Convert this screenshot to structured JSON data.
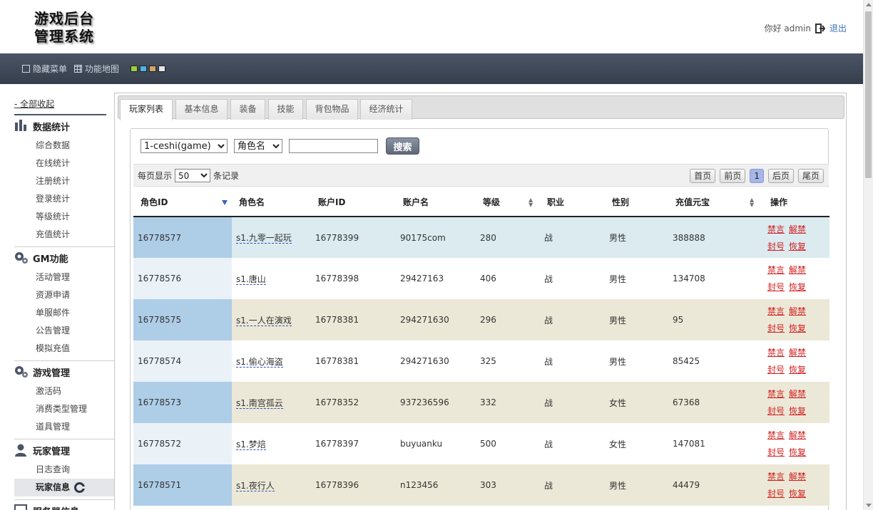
{
  "header": {
    "logo_line1": "游戏后台",
    "logo_line2": "管理系统",
    "greeting": "你好 admin",
    "logout": "退出"
  },
  "toolbar": {
    "hide_menu": "隐藏菜单",
    "function_map": "功能地图",
    "theme_colors": [
      "#9bd13a",
      "#4db4e6",
      "#c9a86b",
      "#e6e6e6"
    ]
  },
  "sidebar": {
    "collapse_all": "- 全部收起",
    "groups": [
      {
        "title": "数据统计",
        "icon": "bar-chart-icon",
        "items": [
          "综合数据",
          "在线统计",
          "注册统计",
          "登录统计",
          "等级统计",
          "充值统计"
        ]
      },
      {
        "title": "GM功能",
        "icon": "gears-icon",
        "items": [
          "活动管理",
          "资源申请",
          "单服邮件",
          "公告管理",
          "模拟充值"
        ]
      },
      {
        "title": "游戏管理",
        "icon": "gears-icon",
        "items": [
          "激活码",
          "消费类型管理",
          "道具管理"
        ]
      },
      {
        "title": "玩家管理",
        "icon": "user-icon",
        "items": [
          "日志查询",
          "玩家信息"
        ]
      },
      {
        "title": "服务器信息",
        "icon": "monitor-icon",
        "items": []
      }
    ],
    "active_item": "玩家信息"
  },
  "tabs": [
    "玩家列表",
    "基本信息",
    "装备",
    "技能",
    "背包物品",
    "经济统计"
  ],
  "filters": {
    "server_selected": "1-ceshi(game)",
    "field_selected": "角色名",
    "search_value": "",
    "search_button": "搜索"
  },
  "paging": {
    "prefix": "每页显示",
    "page_size": "50",
    "suffix": "条记录",
    "first": "首页",
    "prev": "前页",
    "current": "1",
    "next": "后页",
    "last": "尾页"
  },
  "table": {
    "columns": [
      "角色ID",
      "角色名",
      "账户ID",
      "账户名",
      "等级",
      "职业",
      "性别",
      "充值元宝",
      "操作"
    ],
    "op_labels": {
      "mute": "禁言",
      "unmute": "解禁",
      "ban": "封号",
      "restore": "恢复"
    },
    "rows": [
      {
        "role_id": "16778577",
        "role_name": "s1.九零一起玩",
        "account_id": "16778399",
        "account_name": "90175com",
        "level": "280",
        "job": "战",
        "gender": "男性",
        "gold": "388888"
      },
      {
        "role_id": "16778576",
        "role_name": "s1.唐山",
        "account_id": "16778398",
        "account_name": "29427163",
        "level": "406",
        "job": "战",
        "gender": "男性",
        "gold": "134708"
      },
      {
        "role_id": "16778575",
        "role_name": "s1.一人在演戏",
        "account_id": "16778381",
        "account_name": "294271630",
        "level": "296",
        "job": "战",
        "gender": "男性",
        "gold": "95"
      },
      {
        "role_id": "16778574",
        "role_name": "s1.偷心海盗",
        "account_id": "16778381",
        "account_name": "294271630",
        "level": "325",
        "job": "战",
        "gender": "男性",
        "gold": "85425"
      },
      {
        "role_id": "16778573",
        "role_name": "s1.南宫孤云",
        "account_id": "16778352",
        "account_name": "937236596",
        "level": "332",
        "job": "战",
        "gender": "女性",
        "gold": "67368"
      },
      {
        "role_id": "16778572",
        "role_name": "s1.梦焙",
        "account_id": "16778397",
        "account_name": "buyuanku",
        "level": "500",
        "job": "战",
        "gender": "女性",
        "gold": "147081"
      },
      {
        "role_id": "16778571",
        "role_name": "s1.夜行人",
        "account_id": "16778396",
        "account_name": "n123456",
        "level": "303",
        "job": "战",
        "gender": "男性",
        "gold": "44479"
      }
    ]
  }
}
